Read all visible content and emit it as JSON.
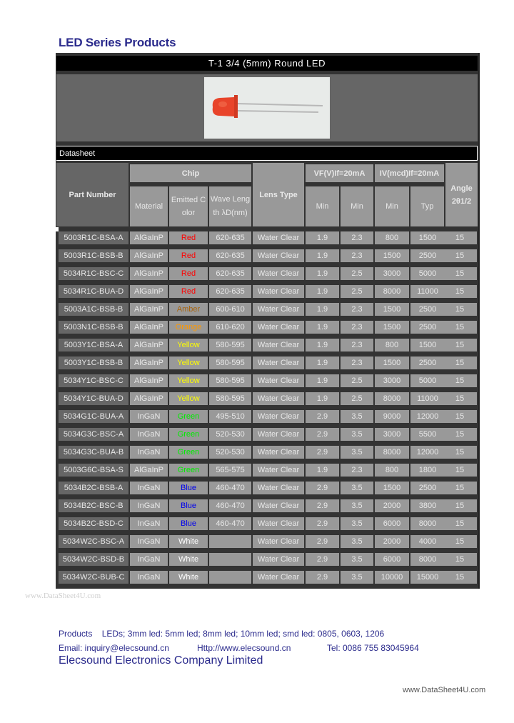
{
  "page_title": "LED Series Products",
  "banner_title": "T-1 3/4 (5mm) Round LED",
  "product_image": {
    "alt": "red-5mm-led-photo",
    "lens_color": "#e8442a"
  },
  "datasheet_label": "Datasheet",
  "table": {
    "headers": {
      "part_number": "Part Number",
      "chip": "Chip",
      "material": "Material",
      "emitted_color": "Emitted C olor",
      "wavelength": "Wave Leng th λD(nm)",
      "lens_type": "Lens Type",
      "vf_group": "VF(V)If=20mA",
      "vf_min1": "Min",
      "vf_min2": "Min",
      "iv_group": "IV(mcd)If=20mA",
      "iv_min": "Min",
      "iv_typ": "Typ",
      "angle": "Angle 2θ1/2"
    },
    "rows": [
      {
        "part": "5003R1C-BSA-A",
        "material": "AlGaInP",
        "color": "Red",
        "color_hex": "#ff0000",
        "wave": "620-635",
        "lens": "Water Clear",
        "vf1": "1.9",
        "vf2": "2.3",
        "iv_min": "800",
        "iv_typ": "1500",
        "angle": "15"
      },
      {
        "part": "5003R1C-BSB-B",
        "material": "AlGaInP",
        "color": "Red",
        "color_hex": "#ff0000",
        "wave": "620-635",
        "lens": "Water Clear",
        "vf1": "1.9",
        "vf2": "2.3",
        "iv_min": "1500",
        "iv_typ": "2500",
        "angle": "15"
      },
      {
        "part": "5034R1C-BSC-C",
        "material": "AlGaInP",
        "color": "Red",
        "color_hex": "#ff0000",
        "wave": "620-635",
        "lens": "Water Clear",
        "vf1": "1.9",
        "vf2": "2.5",
        "iv_min": "3000",
        "iv_typ": "5000",
        "angle": "15"
      },
      {
        "part": "5034R1C-BUA-D",
        "material": "AlGaInP",
        "color": "Red",
        "color_hex": "#ff0000",
        "wave": "620-635",
        "lens": "Water Clear",
        "vf1": "1.9",
        "vf2": "2.5",
        "iv_min": "8000",
        "iv_typ": "11000",
        "angle": "15"
      },
      {
        "part": "5003A1C-BSB-B",
        "material": "AlGaInP",
        "color": "Amber",
        "color_hex": "#a8650f",
        "wave": "600-610",
        "lens": "Water Clear",
        "vf1": "1.9",
        "vf2": "2.3",
        "iv_min": "1500",
        "iv_typ": "2500",
        "angle": "15"
      },
      {
        "part": "5003N1C-BSB-B",
        "material": "AlGaInP",
        "color": "Orange",
        "color_hex": "#ff9900",
        "wave": "610-620",
        "lens": "Water Clear",
        "vf1": "1.9",
        "vf2": "2.3",
        "iv_min": "1500",
        "iv_typ": "2500",
        "angle": "15"
      },
      {
        "part": "5003Y1C-BSA-A",
        "material": "AlGaInP",
        "color": "Yellow",
        "color_hex": "#ffff00",
        "wave": "580-595",
        "lens": "Water Clear",
        "vf1": "1.9",
        "vf2": "2.3",
        "iv_min": "800",
        "iv_typ": "1500",
        "angle": "15"
      },
      {
        "part": "5003Y1C-BSB-B",
        "material": "AlGaInP",
        "color": "Yellow",
        "color_hex": "#ffff00",
        "wave": "580-595",
        "lens": "Water Clear",
        "vf1": "1.9",
        "vf2": "2.3",
        "iv_min": "1500",
        "iv_typ": "2500",
        "angle": "15"
      },
      {
        "part": "5034Y1C-BSC-C",
        "material": "AlGaInP",
        "color": "Yellow",
        "color_hex": "#ffff00",
        "wave": "580-595",
        "lens": "Water Clear",
        "vf1": "1.9",
        "vf2": "2.5",
        "iv_min": "3000",
        "iv_typ": "5000",
        "angle": "15"
      },
      {
        "part": "5034Y1C-BUA-D",
        "material": "AlGaInP",
        "color": "Yellow",
        "color_hex": "#ffff00",
        "wave": "580-595",
        "lens": "Water Clear",
        "vf1": "1.9",
        "vf2": "2.5",
        "iv_min": "8000",
        "iv_typ": "11000",
        "angle": "15"
      },
      {
        "part": "5034G1C-BUA-A",
        "material": "InGaN",
        "color": "Green",
        "color_hex": "#00ee00",
        "wave": "495-510",
        "lens": "Water Clear",
        "vf1": "2.9",
        "vf2": "3.5",
        "iv_min": "9000",
        "iv_typ": "12000",
        "angle": "15"
      },
      {
        "part": "5034G3C-BSC-A",
        "material": "InGaN",
        "color": "Green",
        "color_hex": "#00ee00",
        "wave": "520-530",
        "lens": "Water Clear",
        "vf1": "2.9",
        "vf2": "3.5",
        "iv_min": "3000",
        "iv_typ": "5500",
        "angle": "15"
      },
      {
        "part": "5034G3C-BUA-B",
        "material": "InGaN",
        "color": "Green",
        "color_hex": "#00ee00",
        "wave": "520-530",
        "lens": "Water Clear",
        "vf1": "2.9",
        "vf2": "3.5",
        "iv_min": "8000",
        "iv_typ": "12000",
        "angle": "15"
      },
      {
        "part": "5003G6C-BSA-S",
        "material": "AlGaInP",
        "color": "Green",
        "color_hex": "#00ee00",
        "wave": "565-575",
        "lens": "Water Clear",
        "vf1": "1.9",
        "vf2": "2.3",
        "iv_min": "800",
        "iv_typ": "1800",
        "angle": "15"
      },
      {
        "part": "5034B2C-BSB-A",
        "material": "InGaN",
        "color": "Blue",
        "color_hex": "#0000ee",
        "wave": "460-470",
        "lens": "Water Clear",
        "vf1": "2.9",
        "vf2": "3.5",
        "iv_min": "1500",
        "iv_typ": "2500",
        "angle": "15"
      },
      {
        "part": "5034B2C-BSC-B",
        "material": "InGaN",
        "color": "Blue",
        "color_hex": "#0000ee",
        "wave": "460-470",
        "lens": "Water Clear",
        "vf1": "2.9",
        "vf2": "3.5",
        "iv_min": "2000",
        "iv_typ": "3800",
        "angle": "15"
      },
      {
        "part": "5034B2C-BSD-C",
        "material": "InGaN",
        "color": "Blue",
        "color_hex": "#0000ee",
        "wave": "460-470",
        "lens": "Water Clear",
        "vf1": "2.9",
        "vf2": "3.5",
        "iv_min": "6000",
        "iv_typ": "8000",
        "angle": "15"
      },
      {
        "part": "5034W2C-BSC-A",
        "material": "InGaN",
        "color": "White",
        "color_hex": "#ffffff",
        "wave": "",
        "lens": "Water Clear",
        "vf1": "2.9",
        "vf2": "3.5",
        "iv_min": "2000",
        "iv_typ": "4000",
        "angle": "15"
      },
      {
        "part": "5034W2C-BSD-B",
        "material": "InGaN",
        "color": "White",
        "color_hex": "#ffffff",
        "wave": "",
        "lens": "Water Clear",
        "vf1": "2.9",
        "vf2": "3.5",
        "iv_min": "6000",
        "iv_typ": "8000",
        "angle": "15"
      },
      {
        "part": "5034W2C-BUB-C",
        "material": "InGaN",
        "color": "White",
        "color_hex": "#ffffff",
        "wave": "",
        "lens": "Water Clear",
        "vf1": "2.9",
        "vf2": "3.5",
        "iv_min": "10000",
        "iv_typ": "15000",
        "angle": "15"
      }
    ]
  },
  "watermark_left": "www.DataSheet4U.com",
  "footer": {
    "products_label": "Products",
    "products_text": "LEDs; 3mm led: 5mm led; 8mm led; 10mm led; smd led: 0805, 0603, 1206",
    "email": "Email: inquiry@elecsound.cn",
    "website": "Http://www.elecsound.cn",
    "tel": "Tel: 0086 755 83045964",
    "company": "Elecsound Electronics Company Limited"
  },
  "watermark_right": "www.DataSheet4U.com",
  "colors": {
    "title_blue": "#2a2a8c",
    "frame": "#333333",
    "dark_cell": "#666666",
    "light_cell": "#999999"
  }
}
